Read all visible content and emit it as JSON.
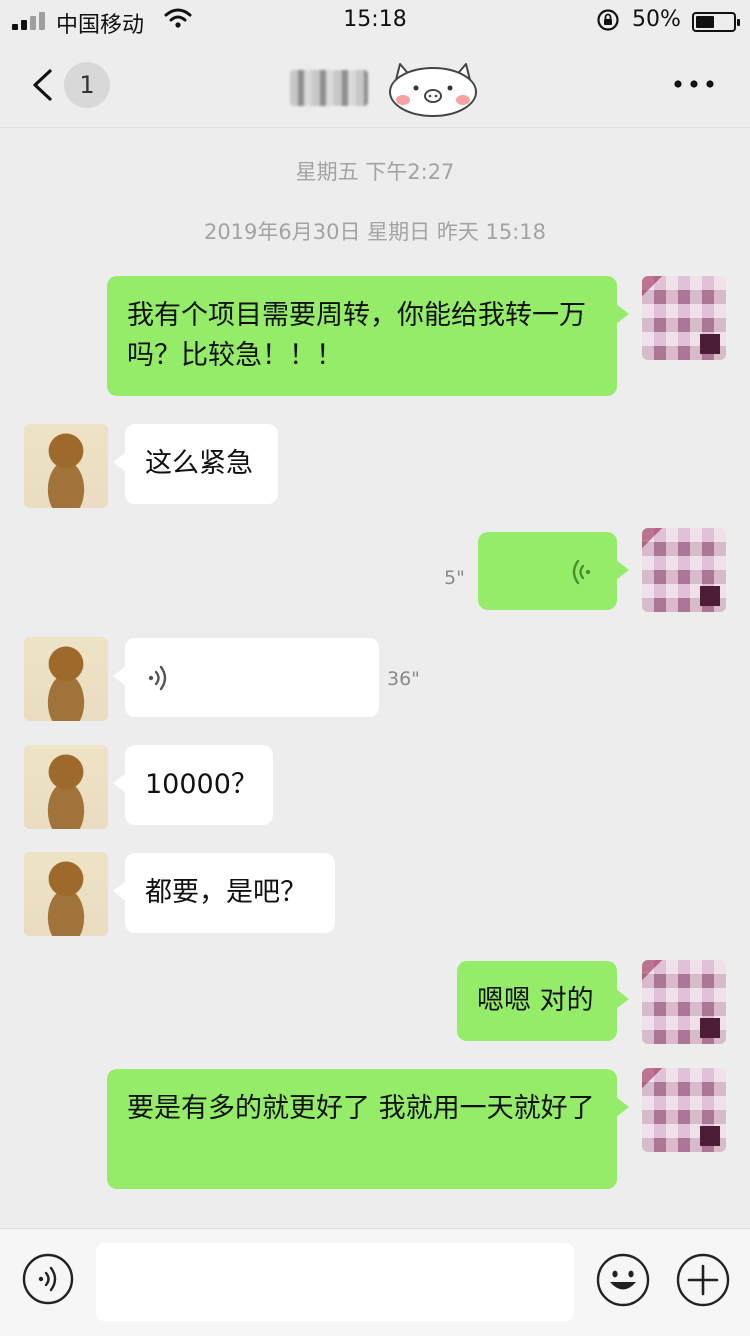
{
  "status_bar": {
    "carrier": "中国移动",
    "time": "15:18",
    "battery": "50%",
    "battery_level": 0.5
  },
  "nav": {
    "unread_count": "1",
    "contact_name": "发发",
    "more_icon": "more-dots-icon",
    "back_icon": "chevron-left-icon",
    "decor_icon": "pig-face-icon"
  },
  "timestamps": [
    "星期五 下午2:27",
    "2019年6月30日 星期日 昨天 15:18"
  ],
  "messages": [
    {
      "side": "out",
      "type": "text",
      "text": "我有个项目需要周转，你能给我转一万吗？比较急！！！"
    },
    {
      "side": "in",
      "type": "text",
      "text": "这么紧急"
    },
    {
      "side": "out",
      "type": "voice",
      "duration": "5\""
    },
    {
      "side": "in",
      "type": "voice",
      "duration": "36\""
    },
    {
      "side": "in",
      "type": "text",
      "text": "10000？"
    },
    {
      "side": "in",
      "type": "text",
      "text": "都要，是吧？"
    },
    {
      "side": "out",
      "type": "text",
      "text": "嗯嗯 对的"
    },
    {
      "side": "out",
      "type": "text",
      "text": "要是有多的就更好了 我就用一天就好了"
    }
  ],
  "input_bar": {
    "voice_icon": "voice-input-icon",
    "emoji_icon": "emoji-icon",
    "plus_icon": "plus-circle-icon",
    "input_value": ""
  },
  "colors": {
    "background": "#ededed",
    "outgoing_bubble": "#95ec69",
    "incoming_bubble": "#ffffff",
    "timestamp_text": "#a3a3a3"
  }
}
